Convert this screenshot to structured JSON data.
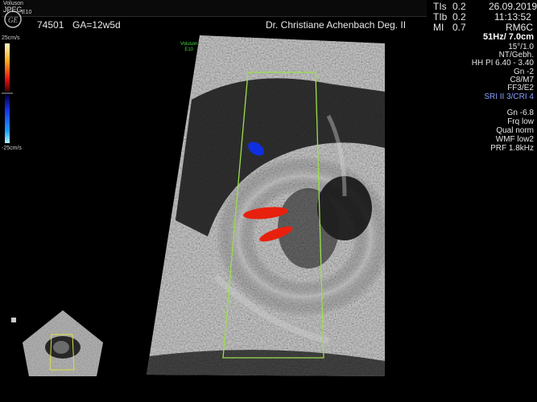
{
  "header": {
    "logo_brand": "Voluson",
    "logo_model": "E10",
    "logo_format": "JPEG",
    "patient_id": "74501",
    "gestational_age": "GA=12w5d",
    "operator": "Dr. Christiane Achenbach Deg. II"
  },
  "indices": {
    "tis_label": "TIs",
    "tis_value": "0.2",
    "tib_label": "TIb",
    "tib_value": "0.2",
    "mi_label": "MI",
    "mi_value": "0.7"
  },
  "datetime": {
    "date": "26.09.2019",
    "time": "11:13:52"
  },
  "probe": "RM6C",
  "params": [
    "51Hz/ 7.0cm",
    "15°/1.0",
    "NT/Gebh.",
    "HH PI 6.40 - 3.40",
    "Gn  -2",
    "C8/M7",
    "FF3/E2"
  ],
  "sri": "SRI II 3/CRI 4",
  "color_params": [
    "Gn -6.8",
    "Frq low",
    "Qual norm",
    "WMF low2",
    "PRF  1.8kHz"
  ],
  "colorbar": {
    "top_label": "25cm/s",
    "bottom_label": "-25cm/s"
  },
  "overlay": {
    "brand": "Voluson",
    "model": "E10"
  },
  "colors": {
    "roi_box": "#9be04a",
    "flow_red": "#e8200e",
    "flow_blue": "#1030e0"
  }
}
